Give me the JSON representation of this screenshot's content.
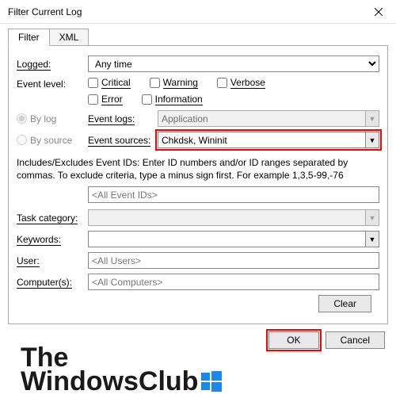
{
  "window": {
    "title": "Filter Current Log"
  },
  "tabs": {
    "filter": "Filter",
    "xml": "XML"
  },
  "labels": {
    "logged": "Logged:",
    "event_level": "Event level:",
    "by_log": "By log",
    "by_source": "By source",
    "event_logs": "Event logs:",
    "event_sources": "Event sources:",
    "task_category": "Task category:",
    "keywords": "Keywords:",
    "user": "User:",
    "computers": "Computer(s):"
  },
  "logged_select": {
    "value": "Any time"
  },
  "levels": {
    "critical": "Critical",
    "warning": "Warning",
    "verbose": "Verbose",
    "error": "Error",
    "information": "Information"
  },
  "event_logs_value": "Application",
  "event_sources_value": "Chkdsk, Wininit",
  "help_text": "Includes/Excludes Event IDs: Enter ID numbers and/or ID ranges separated by commas. To exclude criteria, type a minus sign first. For example 1,3,5-99,-76",
  "event_ids_placeholder": "<All Event IDs>",
  "task_category_value": "",
  "keywords_value": "",
  "user_placeholder": "<All Users>",
  "computers_placeholder": "<All Computers>",
  "buttons": {
    "clear": "Clear",
    "ok": "OK",
    "cancel": "Cancel"
  },
  "watermark": {
    "line1": "The",
    "line2": "WindowsClub"
  }
}
